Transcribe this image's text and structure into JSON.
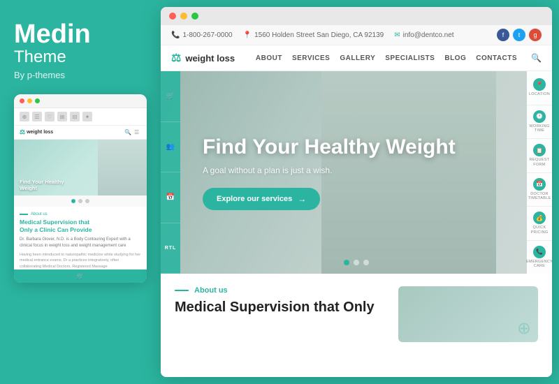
{
  "left": {
    "brand_name": "Medin",
    "brand_sub": "Theme",
    "brand_by": "By p-themes",
    "mini": {
      "hero_text": "Find Your Healthy Weight",
      "about_label": "About us",
      "about_title_main": "Medical Supervision that",
      "about_title_link": "Clinic Can Provide",
      "about_title_only": "Only a",
      "about_desc": "Dr. Barbara Glover, N.D. is a Body Contouring Expert with a clinical focus in weight loss and weight management care",
      "about_para": "Having been introduced to naturopathic medicine while studying for her medical entrance exams, Dr a practices integratively, often collaborating Medical Doctors, Registered Massage"
    }
  },
  "site": {
    "infobar": {
      "phone": "1-800-267-0000",
      "address": "1560 Holden Street San Diego, CA 92139",
      "email": "info@dentco.net"
    },
    "nav": {
      "logo_text": "weight loss",
      "links": [
        "ABOUT",
        "SERVICES",
        "GALLERY",
        "SPECIALISTS",
        "BLOG",
        "CONTACTS"
      ]
    },
    "hero": {
      "title": "Find Your Healthy Weight",
      "subtitle": "A goal without a plan is just a wish.",
      "btn_label": "Explore our services",
      "slider_dots": [
        true,
        false,
        false
      ]
    },
    "right_sidebar": [
      {
        "icon": "📍",
        "label": "LOCATION"
      },
      {
        "icon": "🕐",
        "label": "WORKING TIME"
      },
      {
        "icon": "📋",
        "label": "REQUEST FORM"
      },
      {
        "icon": "📅",
        "label": "DOCTOR TIMETABLE"
      },
      {
        "icon": "💰",
        "label": "QUICK PRICING"
      },
      {
        "icon": "📞",
        "label": "EMERGENCY CARE"
      }
    ],
    "left_sidebar": [
      "🛒",
      "👥",
      "📅",
      "RTL"
    ],
    "about": {
      "label": "About us",
      "title": "Medical Supervision that Only"
    }
  },
  "colors": {
    "teal": "#2bb5a0",
    "teal_dark": "#239e8c",
    "white": "#ffffff"
  }
}
